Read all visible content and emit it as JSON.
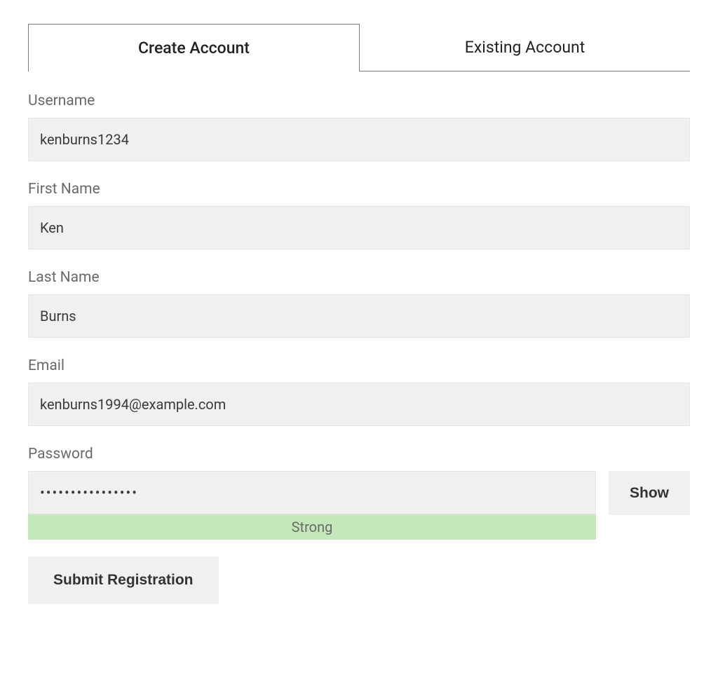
{
  "tabs": {
    "create": "Create Account",
    "existing": "Existing Account"
  },
  "fields": {
    "username": {
      "label": "Username",
      "value": "kenburns1234"
    },
    "first_name": {
      "label": "First Name",
      "value": "Ken"
    },
    "last_name": {
      "label": "Last Name",
      "value": "Burns"
    },
    "email": {
      "label": "Email",
      "value": "kenburns1994@example.com"
    },
    "password": {
      "label": "Password",
      "value": "••••••••••••••••",
      "strength": "Strong"
    }
  },
  "buttons": {
    "show": "Show",
    "submit": "Submit Registration"
  }
}
